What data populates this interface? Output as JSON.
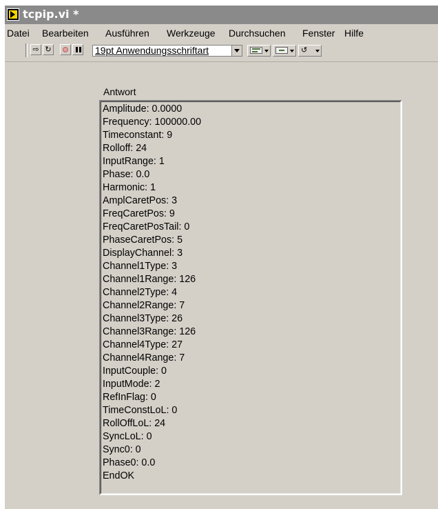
{
  "window": {
    "title": "tcpip.vi *"
  },
  "menu": {
    "items": [
      "Datei",
      "Bearbeiten",
      "Ausführen",
      "Werkzeuge",
      "Durchsuchen",
      "Fenster",
      "Hilfe"
    ]
  },
  "toolbar": {
    "run_icon": "run-arrow-icon",
    "run_continuous_icon": "run-continuously-icon",
    "abort_icon": "abort-icon",
    "pause_icon": "pause-icon",
    "font_value": "19pt Anwendungsschriftart",
    "align_icon": "align-objects-icon",
    "distribute_icon": "distribute-objects-icon",
    "reorder_icon": "reorder-icon"
  },
  "indicator": {
    "label": "Antwort",
    "lines": [
      "Amplitude: 0.0000",
      "Frequency: 100000.00",
      "Timeconstant: 9",
      "Rolloff: 24",
      "InputRange: 1",
      "Phase: 0.0",
      "Harmonic: 1",
      "AmplCaretPos: 3",
      "FreqCaretPos: 9",
      "FreqCaretPosTail: 0",
      "PhaseCaretPos: 5",
      "DisplayChannel: 3",
      "Channel1Type: 3",
      "Channel1Range: 126",
      "Channel2Type: 4",
      "Channel2Range: 7",
      "Channel3Type: 26",
      "Channel3Range: 126",
      "Channel4Type: 27",
      "Channel4Range: 7",
      "InputCouple: 0",
      "InputMode: 2",
      "RefInFlag: 0",
      "TimeConstLoL: 0",
      "RollOffLoL: 24",
      "SyncLoL: 0",
      "Sync0: 0",
      "Phase0: 0.0",
      "EndOK"
    ]
  }
}
